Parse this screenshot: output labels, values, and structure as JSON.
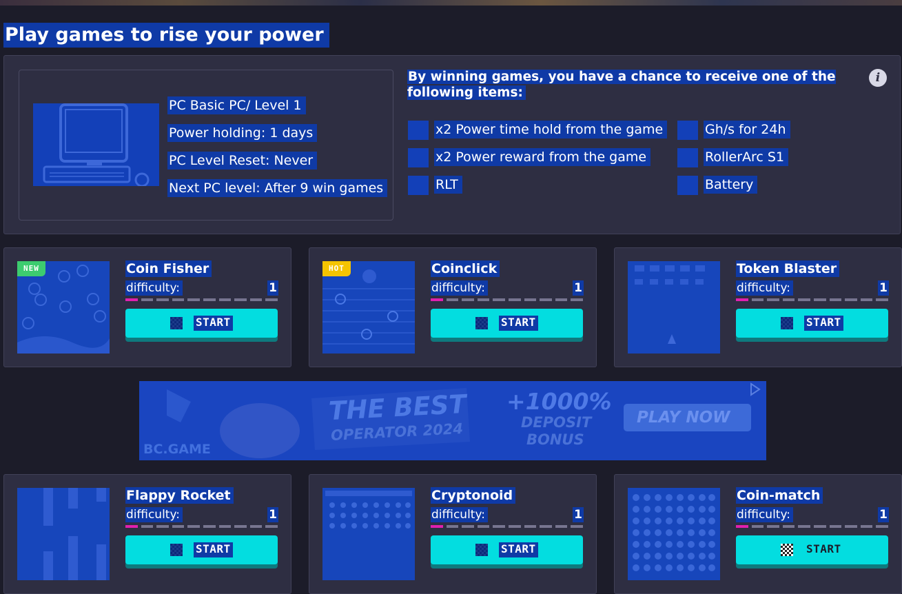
{
  "page": {
    "title": "Play games to rise your power"
  },
  "pc": {
    "name": "PC Basic PC/ Level 1",
    "power_holding": "Power holding: 1 days",
    "level_reset": "PC Level Reset: Never",
    "next_level": "Next PC level: After 9 win games"
  },
  "rewards": {
    "title": "By winning games, you have a chance to receive one of the following items:",
    "info_icon": "i",
    "items": [
      {
        "label": "x2 Power time hold from the game",
        "icon": "power-time-icon"
      },
      {
        "label": "x2 Power reward from the game",
        "icon": "power-reward-icon"
      },
      {
        "label": "RLT",
        "icon": "rlt-token-icon"
      },
      {
        "label": "Gh/s for 24h",
        "icon": "hashrate-icon"
      },
      {
        "label": "RollerArc S1",
        "icon": "miner-icon"
      },
      {
        "label": "Battery",
        "icon": "battery-icon"
      }
    ]
  },
  "difficulty_label": "difficulty:",
  "start_label": "START",
  "games": [
    {
      "name": "Coin Fisher",
      "difficulty": "1",
      "badge": "NEW"
    },
    {
      "name": "Coinclick",
      "difficulty": "1",
      "badge": "HOT"
    },
    {
      "name": "Token Blaster",
      "difficulty": "1"
    },
    {
      "name": "Flappy Rocket",
      "difficulty": "1"
    },
    {
      "name": "Cryptonoid",
      "difficulty": "1"
    },
    {
      "name": "Coin-match",
      "difficulty": "1"
    }
  ],
  "banner": {
    "brand": "BC.GAME",
    "headline": "THE BEST",
    "subheadline": "OPERATOR 2024",
    "offer": "+1000%",
    "offer_line2": "DEPOSIT",
    "offer_line3": "BONUS",
    "cta": "PLAY NOW"
  },
  "colors": {
    "background": "#1c1c29",
    "panel": "#2e2e42",
    "start_button": "#03dde0",
    "difficulty_on": "#e020b0",
    "badge_new": "#3dcc6f",
    "badge_hot": "#f5c400"
  }
}
